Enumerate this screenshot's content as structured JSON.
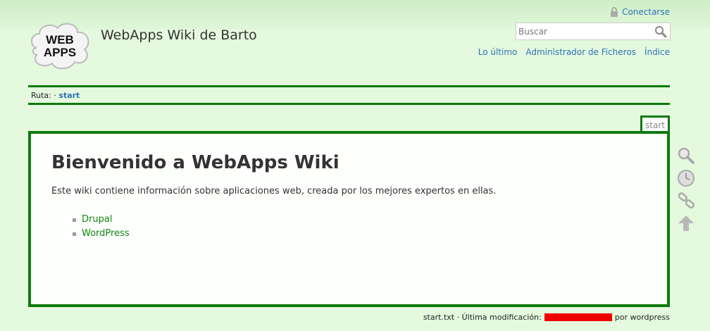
{
  "site": {
    "title": "WebApps Wiki de Barto",
    "logo_line1": "WEB",
    "logo_line2": "APPS"
  },
  "header": {
    "login_label": "Conectarse",
    "search_placeholder": "Buscar",
    "search_value": "",
    "tools": [
      "Lo último",
      "Administrador de Ficheros",
      "Índice"
    ]
  },
  "breadcrumb": {
    "label": "Ruta:",
    "separator": "·",
    "current": "start"
  },
  "page": {
    "tab_label": "start",
    "heading": "Bienvenido a WebApps Wiki",
    "intro": "Este wiki contiene información sobre aplicaciones web, creada por los mejores expertos en ellas.",
    "links": [
      "Drupal",
      "WordPress"
    ]
  },
  "pagetools": [
    "search-icon",
    "clock-icon",
    "link-icon",
    "arrow-up-icon"
  ],
  "footer": {
    "file": "start.txt",
    "modified_label": "· Última modificación:",
    "by": "por wordpress"
  },
  "colors": {
    "background": "#e4f9de",
    "accent_green": "#0d7a0d",
    "link_blue": "#2b73b7",
    "link_green": "#118811",
    "redaction": "#ef0000"
  }
}
